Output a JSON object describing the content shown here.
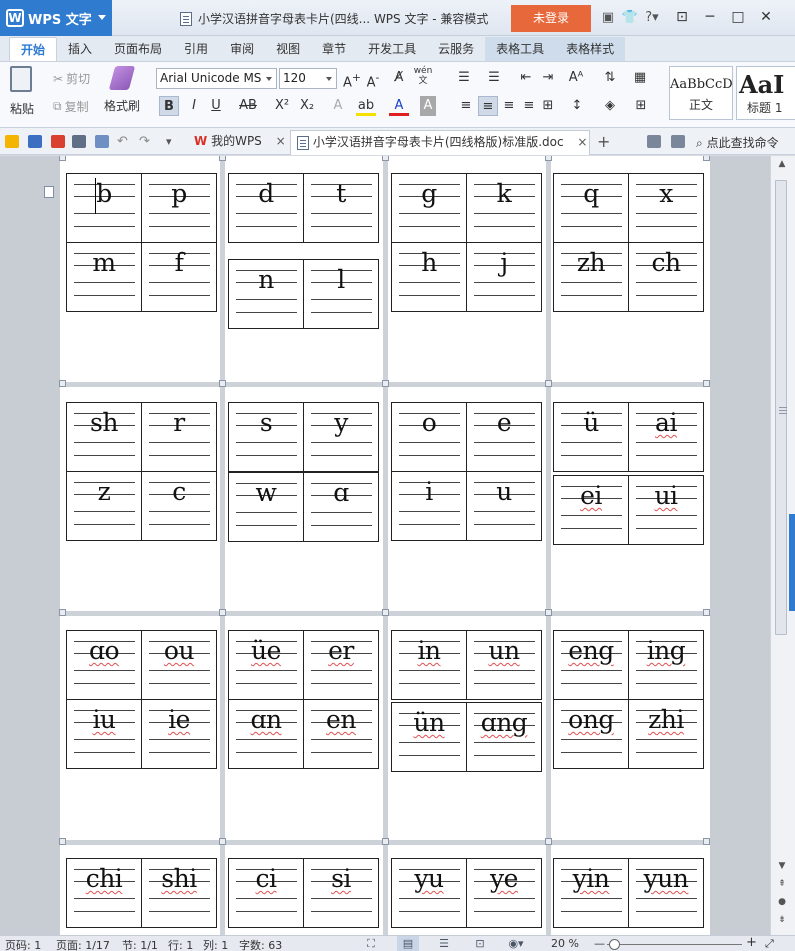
{
  "titlebar": {
    "app_name": "WPS 文字",
    "w_logo": "W",
    "document_title": "小学汉语拼音字母表卡片(四线... WPS 文字 - 兼容模式",
    "login_label": "未登录",
    "icons": [
      "skin-icon",
      "shirt-icon",
      "help-icon",
      "collapse-ribbon-icon"
    ]
  },
  "menu": {
    "tabs": [
      "开始",
      "插入",
      "页面布局",
      "引用",
      "审阅",
      "视图",
      "章节",
      "开发工具",
      "云服务",
      "表格工具",
      "表格样式"
    ],
    "active": "开始"
  },
  "ribbon": {
    "paste": "粘贴",
    "cut": "剪切",
    "copy": "复制",
    "format_painter": "格式刷",
    "font_name": "Arial Unicode MS",
    "font_size": "120",
    "style_normal_sample": "AaBbCcD",
    "style_normal_name": "正文",
    "style_heading_sample": "AaI",
    "style_heading_name": "标题 1",
    "pinyin_button": "wén\n文"
  },
  "quickbar": {
    "my_wps_tab": "我的WPS",
    "doc_tab": "小学汉语拼音字母表卡片(四线格版)标准版.doc",
    "search_command": "点此查找命令"
  },
  "cards": [
    {
      "col": 0,
      "row": 0,
      "letters": [
        "b",
        "p",
        "m",
        "f"
      ]
    },
    {
      "col": 1,
      "row": 0,
      "letters": [
        "d",
        "t",
        "n",
        "l"
      ]
    },
    {
      "col": 2,
      "row": 0,
      "letters": [
        "g",
        "k",
        "h",
        "j"
      ]
    },
    {
      "col": 3,
      "row": 0,
      "letters": [
        "q",
        "x",
        "zh",
        "ch"
      ]
    },
    {
      "col": 0,
      "row": 1,
      "letters": [
        "sh",
        "r",
        "z",
        "c"
      ]
    },
    {
      "col": 1,
      "row": 1,
      "letters": [
        "s",
        "y",
        "w",
        "ɑ"
      ]
    },
    {
      "col": 2,
      "row": 1,
      "letters": [
        "o",
        "e",
        "i",
        "u"
      ]
    },
    {
      "col": 3,
      "row": 1,
      "letters": [
        "ü",
        "ai",
        "ei",
        "ui"
      ]
    },
    {
      "col": 0,
      "row": 2,
      "letters": [
        "ɑo",
        "ou",
        "iu",
        "ie"
      ]
    },
    {
      "col": 1,
      "row": 2,
      "letters": [
        "üe",
        "er",
        "ɑn",
        "en"
      ]
    },
    {
      "col": 2,
      "row": 2,
      "letters": [
        "in",
        "un",
        "ün",
        "ɑng"
      ]
    },
    {
      "col": 3,
      "row": 2,
      "letters": [
        "eng",
        "ing",
        "ong",
        "zhi"
      ]
    },
    {
      "col": 0,
      "row": 3,
      "letters": [
        "chi",
        "shi"
      ]
    },
    {
      "col": 1,
      "row": 3,
      "letters": [
        "ci",
        "si"
      ]
    },
    {
      "col": 2,
      "row": 3,
      "letters": [
        "yu",
        "ye"
      ]
    },
    {
      "col": 3,
      "row": 3,
      "letters": [
        "yin",
        "yun"
      ]
    }
  ],
  "status": {
    "page": "页码: 1",
    "pages": "页面: 1/17",
    "section": "节: 1/1",
    "line": "行: 1",
    "column": "列: 1",
    "words": "字数: 63",
    "zoom": "20 %",
    "zoom_fraction": 0.05
  }
}
